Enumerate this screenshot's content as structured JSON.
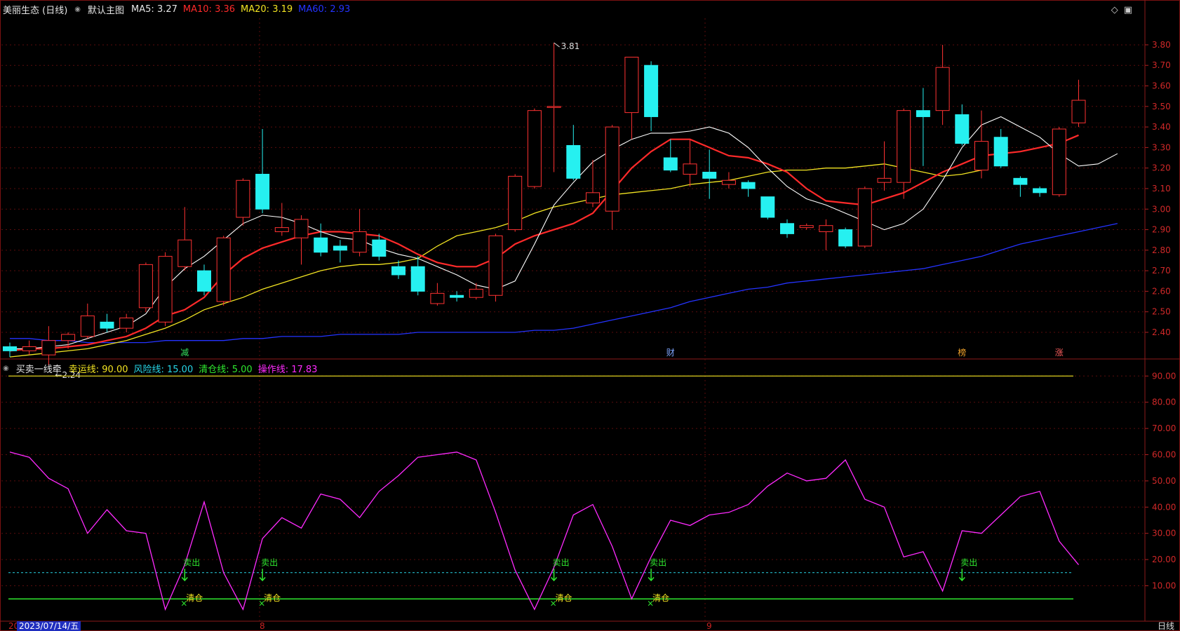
{
  "main_panel": {
    "title": "美丽生态 (日线)",
    "template": "默认主图",
    "ma": [
      {
        "label": "MA5:",
        "value": "3.27",
        "color": "#ffffff"
      },
      {
        "label": "MA10:",
        "value": "3.36",
        "color": "#ff2a2a"
      },
      {
        "label": "MA20:",
        "value": "3.19",
        "color": "#f2e422"
      },
      {
        "label": "MA60:",
        "value": "2.93",
        "color": "#2433ff"
      }
    ],
    "high_marker": "3.81",
    "low_marker": "←2.24",
    "event_tags": [
      {
        "text": "减",
        "color": "#35e35f"
      },
      {
        "text": "财",
        "color": "#7fa6ff"
      },
      {
        "text": "榜",
        "color": "#f2a32a"
      },
      {
        "text": "涨",
        "color": "#ff5e5e"
      }
    ],
    "y_ticks": [
      "3.80",
      "3.70",
      "3.60",
      "3.50",
      "3.40",
      "3.30",
      "3.20",
      "3.10",
      "3.00",
      "2.90",
      "2.80",
      "2.70",
      "2.60",
      "2.50",
      "2.40"
    ]
  },
  "sub_panel": {
    "title": "买卖一线牵",
    "params": [
      {
        "label": "幸运线:",
        "value": "90.00",
        "color": "#f2e422"
      },
      {
        "label": "风险线:",
        "value": "15.00",
        "color": "#27d5e6"
      },
      {
        "label": "清仓线:",
        "value": "5.00",
        "color": "#2fe82f"
      },
      {
        "label": "操作线:",
        "value": "17.83",
        "color": "#ff2aff"
      }
    ],
    "y_ticks": [
      "90.00",
      "80.00",
      "70.00",
      "60.00",
      "50.00",
      "40.00",
      "30.00",
      "20.00",
      "10.00"
    ],
    "sell_label": "卖出",
    "clear_label": "清仓"
  },
  "footer": {
    "first_label": "20",
    "date": "2023/07/14/五",
    "month_labels": [
      "8",
      "9"
    ],
    "period": "日线"
  },
  "chart_data": {
    "type": "candlestick",
    "title": "美丽生态 (日线)",
    "ylim_price": [
      2.24,
      3.81
    ],
    "candles": [
      {
        "o": 2.33,
        "c": 2.31,
        "h": 2.35,
        "l": 2.28
      },
      {
        "o": 2.31,
        "c": 2.33,
        "h": 2.36,
        "l": 2.29
      },
      {
        "o": 2.29,
        "c": 2.36,
        "h": 2.43,
        "l": 2.24
      },
      {
        "o": 2.36,
        "c": 2.39,
        "h": 2.4,
        "l": 2.32
      },
      {
        "o": 2.38,
        "c": 2.48,
        "h": 2.54,
        "l": 2.37
      },
      {
        "o": 2.45,
        "c": 2.42,
        "h": 2.49,
        "l": 2.4
      },
      {
        "o": 2.42,
        "c": 2.47,
        "h": 2.49,
        "l": 2.4
      },
      {
        "o": 2.52,
        "c": 2.73,
        "h": 2.74,
        "l": 2.5
      },
      {
        "o": 2.45,
        "c": 2.77,
        "h": 2.79,
        "l": 2.43
      },
      {
        "o": 2.72,
        "c": 2.85,
        "h": 3.01,
        "l": 2.7
      },
      {
        "o": 2.7,
        "c": 2.6,
        "h": 2.73,
        "l": 2.58
      },
      {
        "o": 2.55,
        "c": 2.86,
        "h": 2.87,
        "l": 2.53
      },
      {
        "o": 2.96,
        "c": 3.14,
        "h": 3.15,
        "l": 2.92
      },
      {
        "o": 3.17,
        "c": 3.0,
        "h": 3.39,
        "l": 2.98
      },
      {
        "o": 2.89,
        "c": 2.91,
        "h": 3.03,
        "l": 2.87
      },
      {
        "o": 2.86,
        "c": 2.95,
        "h": 2.97,
        "l": 2.73
      },
      {
        "o": 2.86,
        "c": 2.79,
        "h": 2.93,
        "l": 2.77
      },
      {
        "o": 2.82,
        "c": 2.8,
        "h": 2.85,
        "l": 2.74
      },
      {
        "o": 2.79,
        "c": 2.89,
        "h": 3.0,
        "l": 2.77
      },
      {
        "o": 2.85,
        "c": 2.77,
        "h": 2.88,
        "l": 2.75
      },
      {
        "o": 2.72,
        "c": 2.68,
        "h": 2.75,
        "l": 2.66
      },
      {
        "o": 2.72,
        "c": 2.6,
        "h": 2.77,
        "l": 2.58
      },
      {
        "o": 2.54,
        "c": 2.59,
        "h": 2.64,
        "l": 2.53
      },
      {
        "o": 2.58,
        "c": 2.57,
        "h": 2.6,
        "l": 2.55
      },
      {
        "o": 2.57,
        "c": 2.61,
        "h": 2.64,
        "l": 2.56
      },
      {
        "o": 2.58,
        "c": 2.87,
        "h": 2.88,
        "l": 2.55
      },
      {
        "o": 2.9,
        "c": 3.16,
        "h": 3.17,
        "l": 2.89
      },
      {
        "o": 3.11,
        "c": 3.48,
        "h": 3.49,
        "l": 3.1
      },
      {
        "o": 3.5,
        "c": 3.5,
        "h": 3.81,
        "l": 3.18
      },
      {
        "o": 3.31,
        "c": 3.15,
        "h": 3.41,
        "l": 3.14
      },
      {
        "o": 3.03,
        "c": 3.08,
        "h": 3.24,
        "l": 3.01
      },
      {
        "o": 2.99,
        "c": 3.4,
        "h": 3.41,
        "l": 2.9
      },
      {
        "o": 3.47,
        "c": 3.74,
        "h": 3.74,
        "l": 3.34
      },
      {
        "o": 3.7,
        "c": 3.45,
        "h": 3.72,
        "l": 3.38
      },
      {
        "o": 3.25,
        "c": 3.19,
        "h": 3.34,
        "l": 3.18
      },
      {
        "o": 3.17,
        "c": 3.22,
        "h": 3.34,
        "l": 3.11
      },
      {
        "o": 3.18,
        "c": 3.15,
        "h": 3.29,
        "l": 3.05
      },
      {
        "o": 3.12,
        "c": 3.14,
        "h": 3.18,
        "l": 3.1
      },
      {
        "o": 3.13,
        "c": 3.1,
        "h": 3.14,
        "l": 3.06
      },
      {
        "o": 3.06,
        "c": 2.96,
        "h": 3.06,
        "l": 2.95
      },
      {
        "o": 2.93,
        "c": 2.88,
        "h": 2.95,
        "l": 2.86
      },
      {
        "o": 2.91,
        "c": 2.92,
        "h": 2.93,
        "l": 2.9
      },
      {
        "o": 2.89,
        "c": 2.92,
        "h": 2.95,
        "l": 2.8
      },
      {
        "o": 2.9,
        "c": 2.82,
        "h": 2.91,
        "l": 2.81
      },
      {
        "o": 2.82,
        "c": 3.1,
        "h": 3.11,
        "l": 2.81
      },
      {
        "o": 3.13,
        "c": 3.15,
        "h": 3.33,
        "l": 3.09
      },
      {
        "o": 3.13,
        "c": 3.48,
        "h": 3.49,
        "l": 3.05
      },
      {
        "o": 3.48,
        "c": 3.45,
        "h": 3.59,
        "l": 3.21
      },
      {
        "o": 3.48,
        "c": 3.69,
        "h": 3.8,
        "l": 3.41
      },
      {
        "o": 3.46,
        "c": 3.32,
        "h": 3.51,
        "l": 3.31
      },
      {
        "o": 3.19,
        "c": 3.33,
        "h": 3.48,
        "l": 3.15
      },
      {
        "o": 3.35,
        "c": 3.21,
        "h": 3.39,
        "l": 3.2
      },
      {
        "o": 3.15,
        "c": 3.12,
        "h": 3.16,
        "l": 3.06
      },
      {
        "o": 3.1,
        "c": 3.08,
        "h": 3.11,
        "l": 3.06
      },
      {
        "o": 3.07,
        "c": 3.39,
        "h": 3.4,
        "l": 3.06
      },
      {
        "o": 3.42,
        "c": 3.53,
        "h": 3.63,
        "l": 3.4
      }
    ],
    "ma5": [
      2.32,
      2.32,
      2.33,
      2.34,
      2.37,
      2.4,
      2.43,
      2.49,
      2.62,
      2.71,
      2.77,
      2.85,
      2.93,
      2.97,
      2.96,
      2.93,
      2.89,
      2.86,
      2.85,
      2.81,
      2.78,
      2.76,
      2.72,
      2.68,
      2.63,
      2.61,
      2.65,
      2.83,
      3.02,
      3.13,
      3.23,
      3.29,
      3.34,
      3.37,
      3.37,
      3.38,
      3.4,
      3.37,
      3.3,
      3.2,
      3.11,
      3.05,
      3.02,
      2.98,
      2.94,
      2.9,
      2.93,
      3.0,
      3.14,
      3.3,
      3.41,
      3.45,
      3.4,
      3.35,
      3.27,
      3.21,
      3.22,
      3.27
    ],
    "ma10": [
      2.31,
      2.32,
      2.32,
      2.33,
      2.34,
      2.36,
      2.38,
      2.42,
      2.48,
      2.51,
      2.57,
      2.68,
      2.76,
      2.81,
      2.84,
      2.87,
      2.89,
      2.89,
      2.88,
      2.87,
      2.83,
      2.78,
      2.74,
      2.72,
      2.72,
      2.76,
      2.83,
      2.87,
      2.9,
      2.93,
      2.98,
      3.09,
      3.2,
      3.28,
      3.34,
      3.34,
      3.3,
      3.26,
      3.25,
      3.22,
      3.18,
      3.1,
      3.04,
      3.03,
      3.02,
      3.05,
      3.08,
      3.13,
      3.18,
      3.22,
      3.26,
      3.27,
      3.28,
      3.3,
      3.32,
      3.36
    ],
    "ma20": [
      2.28,
      2.29,
      2.3,
      2.31,
      2.32,
      2.34,
      2.36,
      2.39,
      2.42,
      2.46,
      2.51,
      2.54,
      2.57,
      2.61,
      2.64,
      2.67,
      2.7,
      2.72,
      2.73,
      2.73,
      2.74,
      2.76,
      2.82,
      2.87,
      2.89,
      2.91,
      2.94,
      2.98,
      3.01,
      3.03,
      3.05,
      3.07,
      3.08,
      3.09,
      3.1,
      3.12,
      3.13,
      3.14,
      3.16,
      3.18,
      3.19,
      3.19,
      3.2,
      3.2,
      3.21,
      3.22,
      3.2,
      3.18,
      3.16,
      3.17,
      3.19
    ],
    "ma60": [
      2.37,
      2.37,
      2.36,
      2.36,
      2.35,
      2.35,
      2.35,
      2.35,
      2.36,
      2.36,
      2.36,
      2.36,
      2.37,
      2.37,
      2.38,
      2.38,
      2.38,
      2.39,
      2.39,
      2.39,
      2.39,
      2.4,
      2.4,
      2.4,
      2.4,
      2.4,
      2.4,
      2.41,
      2.41,
      2.42,
      2.44,
      2.46,
      2.48,
      2.5,
      2.52,
      2.55,
      2.57,
      2.59,
      2.61,
      2.62,
      2.64,
      2.65,
      2.66,
      2.67,
      2.68,
      2.69,
      2.7,
      2.71,
      2.73,
      2.75,
      2.77,
      2.8,
      2.83,
      2.85,
      2.87,
      2.89,
      2.91,
      2.93
    ],
    "oscillator": {
      "name": "操作线",
      "ylim": [
        0,
        100
      ],
      "lines": {
        "幸运线": 90,
        "风险线": 15,
        "清仓线": 5
      },
      "values": [
        61,
        59,
        51,
        47,
        30,
        39,
        31,
        30,
        1,
        18,
        42,
        15,
        1,
        28,
        36,
        32,
        45,
        43,
        36,
        46,
        52,
        59,
        60,
        61,
        58,
        38,
        16,
        1,
        17,
        37,
        41,
        25,
        5,
        21,
        35,
        33,
        37,
        38,
        41,
        48,
        53,
        50,
        51,
        58,
        43,
        40,
        21,
        23,
        8,
        31,
        30,
        37,
        44,
        46,
        27,
        18
      ]
    }
  }
}
